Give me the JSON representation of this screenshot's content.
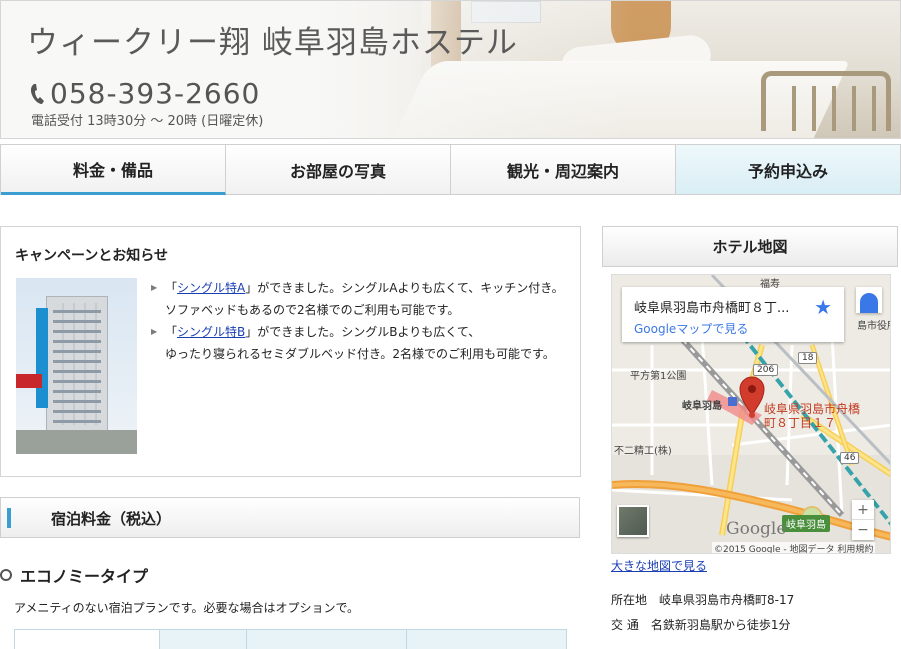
{
  "header": {
    "hotel_name": "ウィークリー翔 岐阜羽島ホステル",
    "phone": "058-393-2660",
    "hours": "電話受付 13時30分 ～ 20時 (日曜定休)"
  },
  "nav": {
    "tabs": [
      {
        "label": "料金・備品"
      },
      {
        "label": "お部屋の写真"
      },
      {
        "label": "観光・周辺案内"
      },
      {
        "label": "予約申込み"
      }
    ]
  },
  "campaign": {
    "title": "キャンペーンとお知らせ",
    "item1_pre": "「",
    "item1_link": "シングル特A",
    "item1_post": "」ができました。シングルAよりも広くて、キッチン付き。",
    "item1_line2": "ソファベッドもあるので2名様でのご利用も可能です。",
    "item2_pre": "「",
    "item2_link": "シングル特B",
    "item2_post": "」ができました。シングルBよりも広くて、",
    "item2_line2": "ゆったり寝られるセミダブルベッド付き。2名様でのご利用も可能です。"
  },
  "section": {
    "title": "宿泊料金（税込）"
  },
  "economy": {
    "title": "エコノミータイプ",
    "desc": "アメニティのない宿泊プランです。必要な場合はオプションで。"
  },
  "map": {
    "heading": "ホテル地図",
    "card_address": "岐阜県羽島市舟橋町８丁...",
    "card_link": "Googleマップで見る",
    "pin_label_line1": "岐阜県羽島市舟橋",
    "pin_label_line2": "町８丁目１７",
    "labels": {
      "park": "平方第1公園",
      "station": "岐阜羽島",
      "factory": "不二精工(株)",
      "city_office": "島市役所前",
      "fukuju": "福寿",
      "station_badge": "岐阜羽島"
    },
    "routes": [
      "206",
      "18",
      "46"
    ],
    "google": "Google",
    "copyright": "©2015 Google - 地図データ 利用規約",
    "zoom_in": "+",
    "zoom_out": "−",
    "big_map_link": "大きな地図で見る"
  },
  "info": {
    "address_label": "所在地",
    "address": "岐阜県羽島市舟橋町8-17",
    "access_label": "交 通",
    "access": "名鉄新羽島駅から徒歩1分"
  },
  "colors": {
    "accent": "#3a9fd0",
    "link": "#1a3fb3",
    "pin": "#d23c2c"
  }
}
